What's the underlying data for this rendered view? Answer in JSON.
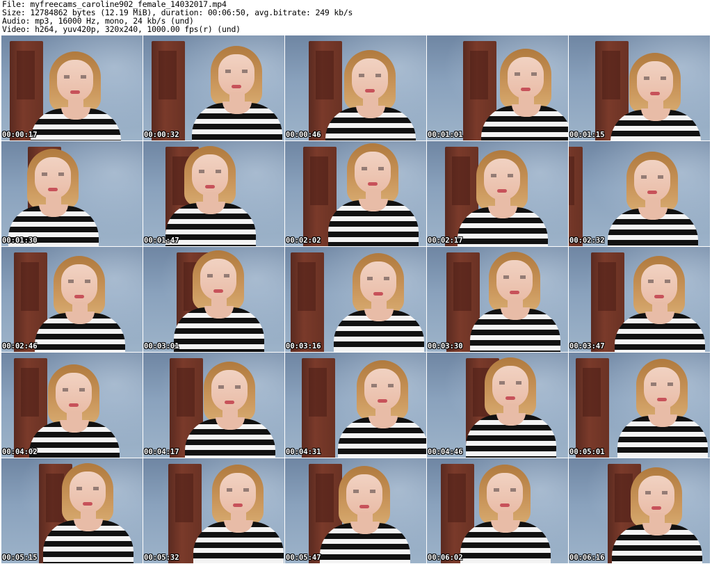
{
  "header": {
    "file_line": "File: myfreecams_caroline902_female_14032017.mp4",
    "size_line": "Size: 12784862 bytes (12.19 MiB), duration: 00:06:50, avg.bitrate: 249 kb/s",
    "audio_line": "Audio: mp3, 16000 Hz, mono, 24 kb/s (und)",
    "video_line": "Video: h264, yuv420p, 320x240, 1000.00 fps(r) (und)"
  },
  "thumbnails": [
    {
      "timestamp": "00:00:17"
    },
    {
      "timestamp": "00:00:32"
    },
    {
      "timestamp": "00:00:46"
    },
    {
      "timestamp": "00:01:01"
    },
    {
      "timestamp": "00:01:15"
    },
    {
      "timestamp": "00:01:30"
    },
    {
      "timestamp": "00:01:47"
    },
    {
      "timestamp": "00:02:02"
    },
    {
      "timestamp": "00:02:17"
    },
    {
      "timestamp": "00:02:32"
    },
    {
      "timestamp": "00:02:46"
    },
    {
      "timestamp": "00:03:01"
    },
    {
      "timestamp": "00:03:16"
    },
    {
      "timestamp": "00:03:30"
    },
    {
      "timestamp": "00:03:47"
    },
    {
      "timestamp": "00:04:02"
    },
    {
      "timestamp": "00:04:17"
    },
    {
      "timestamp": "00:04:31"
    },
    {
      "timestamp": "00:04:46"
    },
    {
      "timestamp": "00:05:01"
    },
    {
      "timestamp": "00:05:15"
    },
    {
      "timestamp": "00:05:32"
    },
    {
      "timestamp": "00:05:47"
    },
    {
      "timestamp": "00:06:02"
    },
    {
      "timestamp": "00:06:16"
    }
  ],
  "colors": {
    "background": "#ffffff",
    "wall": "#8aa2bd",
    "door": "#7a3a2a",
    "hair": "#c9955a",
    "shirt_dark": "#111111",
    "shirt_light": "#f4f4f4",
    "timestamp_text": "#ffffff"
  }
}
